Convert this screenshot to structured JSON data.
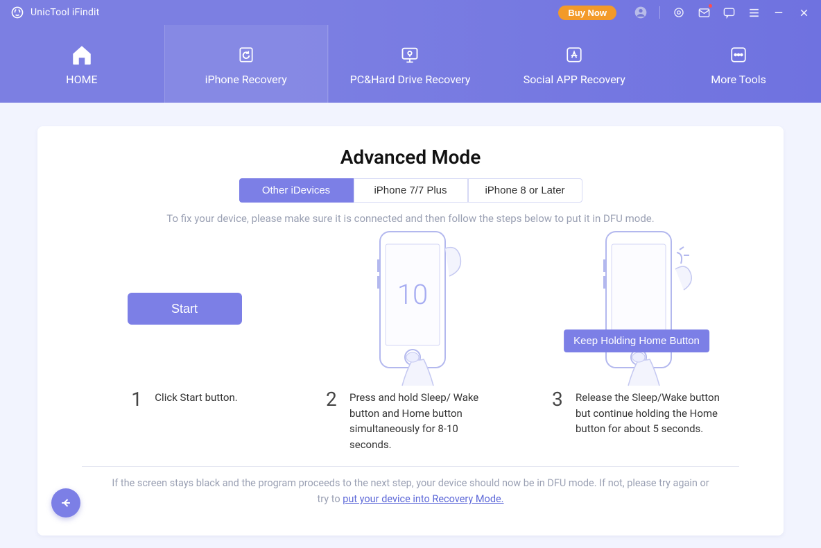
{
  "app": {
    "name": "UnicTool iFindit",
    "buy_now": "Buy Now"
  },
  "nav": {
    "home": "HOME",
    "iphone": "iPhone Recovery",
    "pc": "PC&Hard Drive Recovery",
    "social": "Social APP Recovery",
    "more": "More Tools"
  },
  "main": {
    "title": "Advanced Mode",
    "tabs": {
      "other": "Other iDevices",
      "seven": "iPhone 7/7 Plus",
      "eight": "iPhone 8 or Later"
    },
    "instruction": "To fix your device, please make sure it is connected and then follow the steps below to put it in DFU mode.",
    "start": "Start",
    "countdown": "10",
    "keep_holding": "Keep Holding Home Button",
    "steps": {
      "s1": {
        "num": "1",
        "text": "Click Start button."
      },
      "s2": {
        "num": "2",
        "text": "Press and hold Sleep/ Wake button and Home button simultaneously for 8-10 seconds."
      },
      "s3": {
        "num": "3",
        "text": "Release the Sleep/Wake button but continue holding the Home button for about 5 seconds."
      }
    },
    "footer": {
      "prefix": "If the screen stays black and the program proceeds to the next step, your device should now be in DFU mode. If not, please try again or try to ",
      "link": "put your device into Recovery Mode."
    }
  }
}
